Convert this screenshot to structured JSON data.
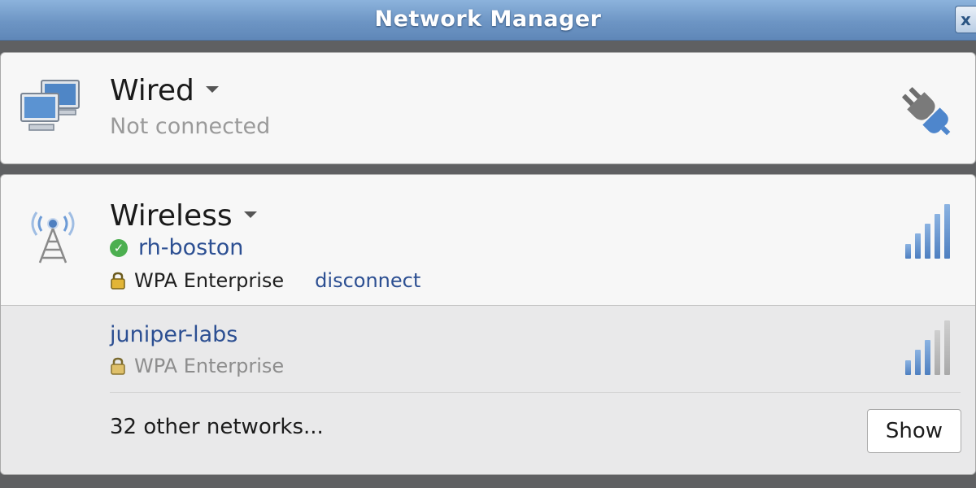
{
  "window": {
    "title": "Network Manager",
    "close_label": "x"
  },
  "wired": {
    "name": "Wired",
    "status": "Not connected",
    "icons": [
      "network-computers-icon",
      "ethernet-plug-icon"
    ]
  },
  "wireless": {
    "name": "Wireless",
    "active": {
      "ssid": "rh-boston",
      "connected": true,
      "security": "WPA Enterprise",
      "action": "disconnect",
      "signal_bars": 5
    },
    "available": [
      {
        "ssid": "juniper-labs",
        "security": "WPA Enterprise",
        "signal_bars": 3
      }
    ],
    "other_networks": "32 other networks...",
    "show_label": "Show"
  },
  "colors": {
    "accent": "#2c4f92",
    "connected": "#4caf50",
    "signal_on": "#4e7fc0",
    "signal_off": "#a9a9a9"
  }
}
